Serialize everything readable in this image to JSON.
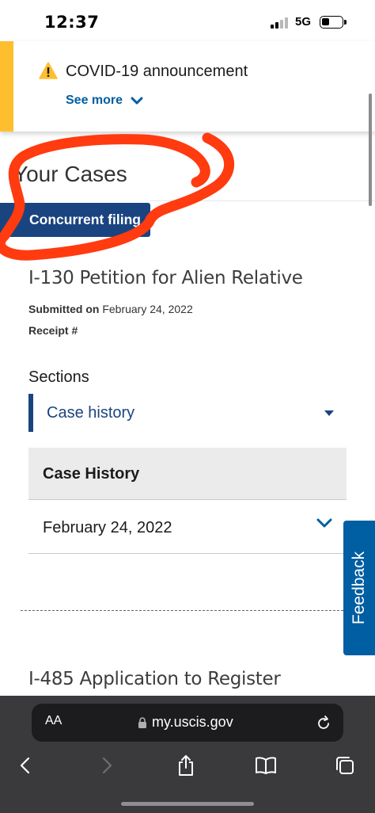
{
  "status_bar": {
    "time": "12:37",
    "network": "5G"
  },
  "alert": {
    "title": "COVID-19 announcement",
    "see_more": "See more",
    "accent_color": "#ffbe2e",
    "icon": "warning-icon"
  },
  "page": {
    "title": "Your Cases",
    "concurrent_label": "Concurrent filing"
  },
  "case": {
    "title": "I-130 Petition for Alien Relative",
    "submitted_label": "Submitted on",
    "submitted_value": "February 24, 2022",
    "receipt_label": "Receipt #",
    "receipt_value": "",
    "sections_label": "Sections",
    "section_selected": "Case history",
    "history_header": "Case History",
    "history_rows": [
      "February 24, 2022"
    ]
  },
  "next_case": {
    "title": "I-485 Application to Register"
  },
  "feedback": {
    "label": "Feedback"
  },
  "browser": {
    "text_size_label": "AA",
    "url": "my.uscis.gov"
  },
  "colors": {
    "primary": "#1a4480",
    "link": "#005ea2",
    "annotation": "#ff3b0f",
    "toolbar": "#3a3a3c"
  }
}
